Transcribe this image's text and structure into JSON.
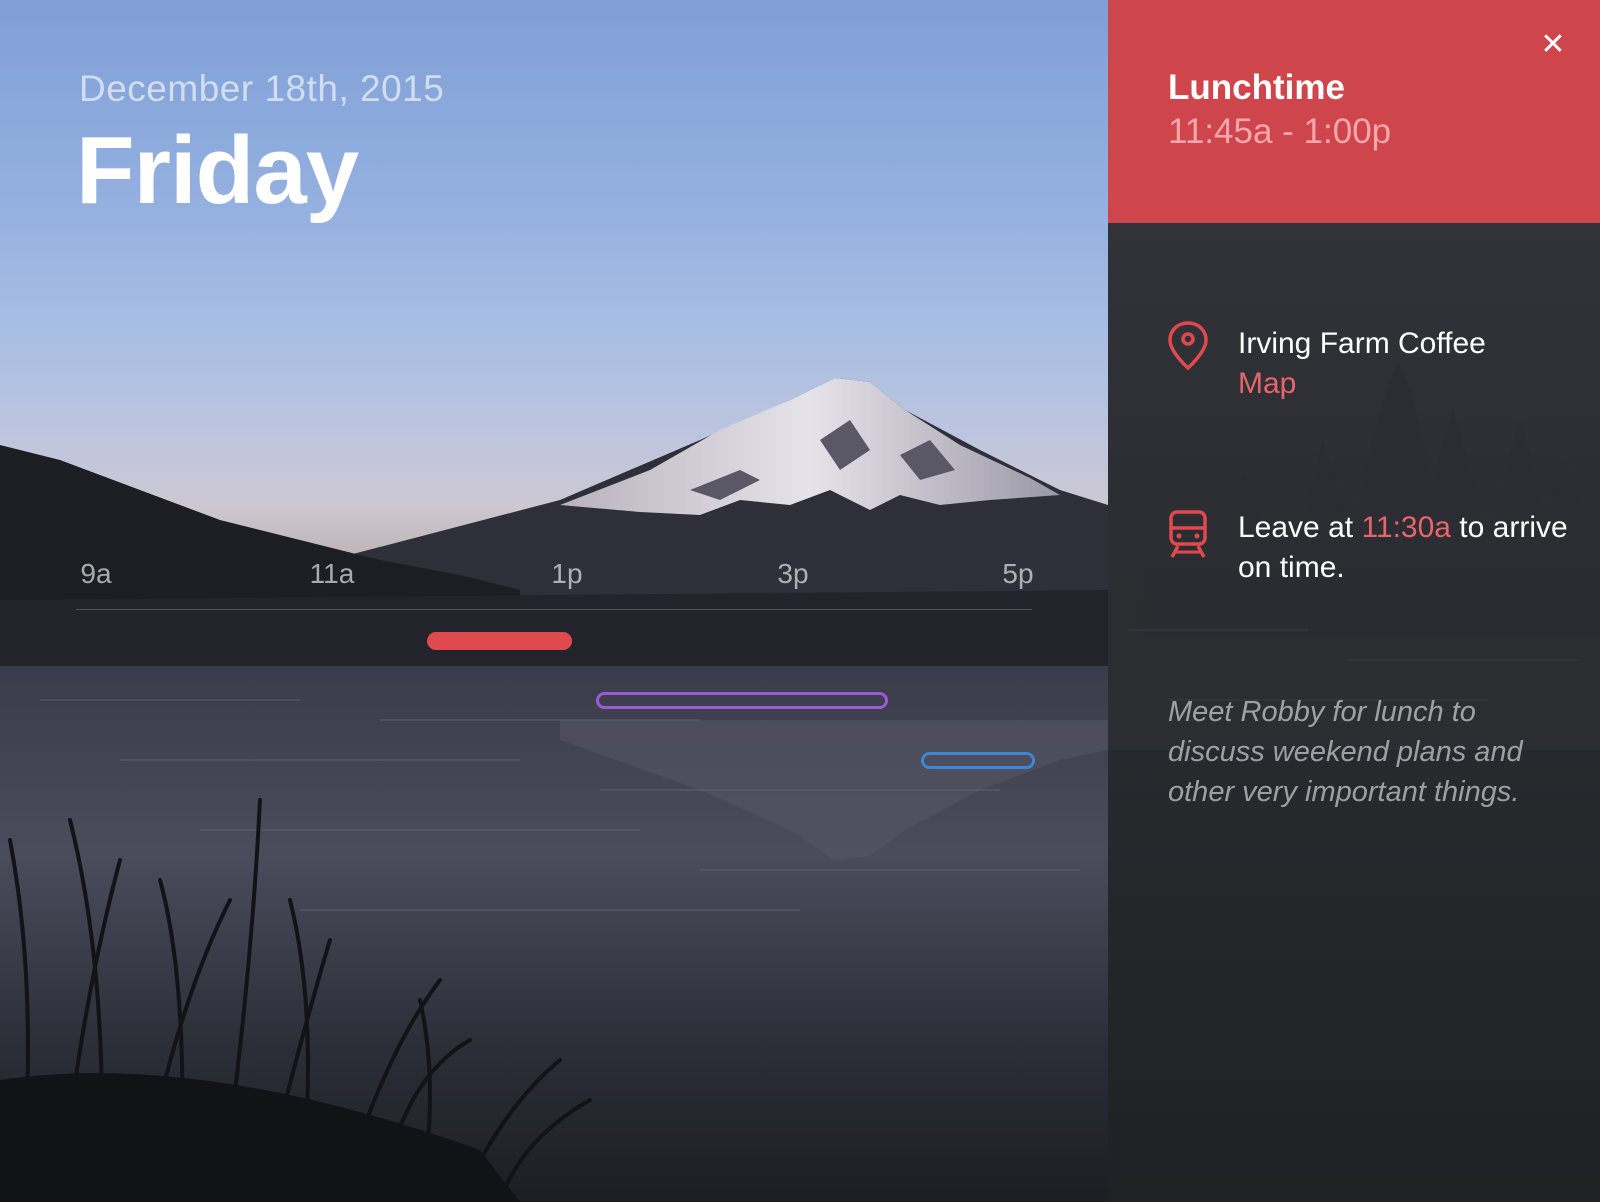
{
  "day": {
    "date": "December 18th, 2015",
    "weekday": "Friday"
  },
  "timeline": {
    "ticks": [
      "9a",
      "11a",
      "1p",
      "3p",
      "5p"
    ],
    "events": [
      {
        "name": "lunchtime",
        "start": "11:45a",
        "end": "1:00p",
        "color": "#e0494d",
        "style": "filled"
      },
      {
        "name": "event-2",
        "start": "1:15p",
        "end": "3:50p",
        "color": "#9b5bd6",
        "style": "outlined"
      },
      {
        "name": "event-3",
        "start": "4:05p",
        "end": "5:05p",
        "color": "#3f86d6",
        "style": "outlined"
      }
    ]
  },
  "detail": {
    "title": "Lunchtime",
    "time": "11:45a - 1:00p",
    "close_icon": "close-icon",
    "location": {
      "icon": "location-pin-icon",
      "name": "Irving Farm Coffee",
      "map_label": "Map"
    },
    "travel": {
      "icon": "train-icon",
      "prefix": "Leave at ",
      "leave_time": "11:30a",
      "suffix": " to arrive on time."
    },
    "note": "Meet Robby for lunch to discuss weekend plans and other very important things."
  },
  "colors": {
    "accent": "#cf454c",
    "accent_text": "#e8656b",
    "panel_bg": "#2a2c31"
  }
}
